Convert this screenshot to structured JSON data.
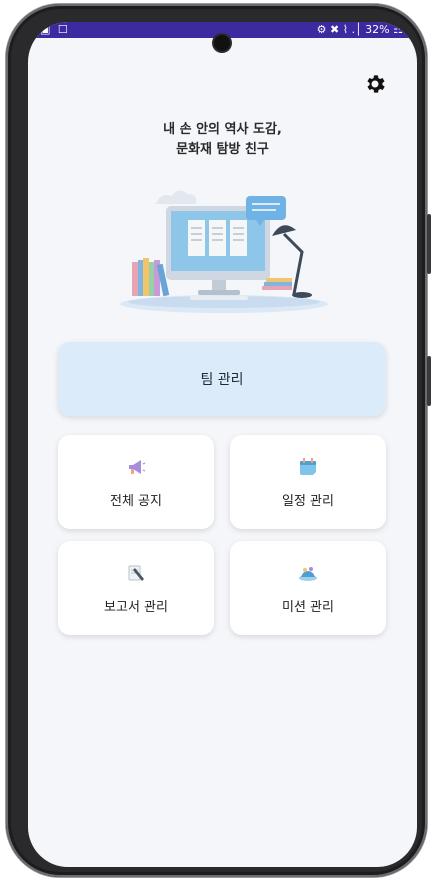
{
  "status_bar": {
    "left_icons": "▣ ☐",
    "right_text": "⚙ ✖ ⌇ .│ 32% ☷"
  },
  "settings": {
    "icon": "gear-icon"
  },
  "tagline": {
    "line1": "내 손 안의 역사 도감,",
    "line2": "문화재 탐방 친구"
  },
  "menu": {
    "team": "팀 관리",
    "notice": "전체 공지",
    "schedule": "일정 관리",
    "report": "보고서 관리",
    "mission": "미션 관리"
  },
  "colors": {
    "status_bar": "#3b2aa0",
    "background": "#f5f6fa",
    "team_card": "#dcebfa"
  }
}
